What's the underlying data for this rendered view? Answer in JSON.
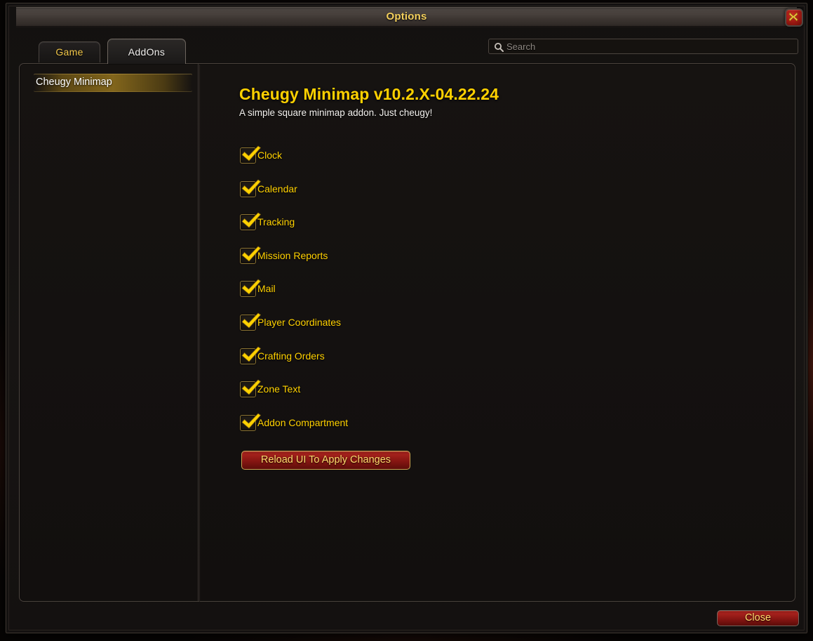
{
  "window": {
    "title": "Options",
    "close_x_icon": "close-icon"
  },
  "tabs": [
    {
      "id": "game",
      "label": "Game",
      "active": false
    },
    {
      "id": "addons",
      "label": "AddOns",
      "active": true
    }
  ],
  "search": {
    "icon": "search-icon",
    "placeholder": "Search",
    "value": ""
  },
  "sidebar": {
    "items": [
      {
        "label": "Cheugy Minimap",
        "selected": true
      }
    ]
  },
  "detail": {
    "title": "Cheugy Minimap v10.2.X-04.22.24",
    "subtitle": "A simple square minimap addon. Just cheugy!",
    "options": [
      {
        "label": "Clock",
        "checked": true
      },
      {
        "label": "Calendar",
        "checked": true
      },
      {
        "label": "Tracking",
        "checked": true
      },
      {
        "label": "Mission Reports",
        "checked": true
      },
      {
        "label": "Mail",
        "checked": true
      },
      {
        "label": "Player Coordinates",
        "checked": true
      },
      {
        "label": "Crafting Orders",
        "checked": true
      },
      {
        "label": "Zone Text",
        "checked": true
      },
      {
        "label": "Addon Compartment",
        "checked": true
      }
    ],
    "reload_button_label": "Reload UI To Apply Changes"
  },
  "footer": {
    "close_label": "Close"
  },
  "colors": {
    "gold_text": "#ffd100",
    "title_gold": "#f3cf5c",
    "panel_bg": "#15110f",
    "button_red": "#a3201b",
    "button_border_gold": "#c9a253",
    "close_x_red": "#a01a13"
  }
}
